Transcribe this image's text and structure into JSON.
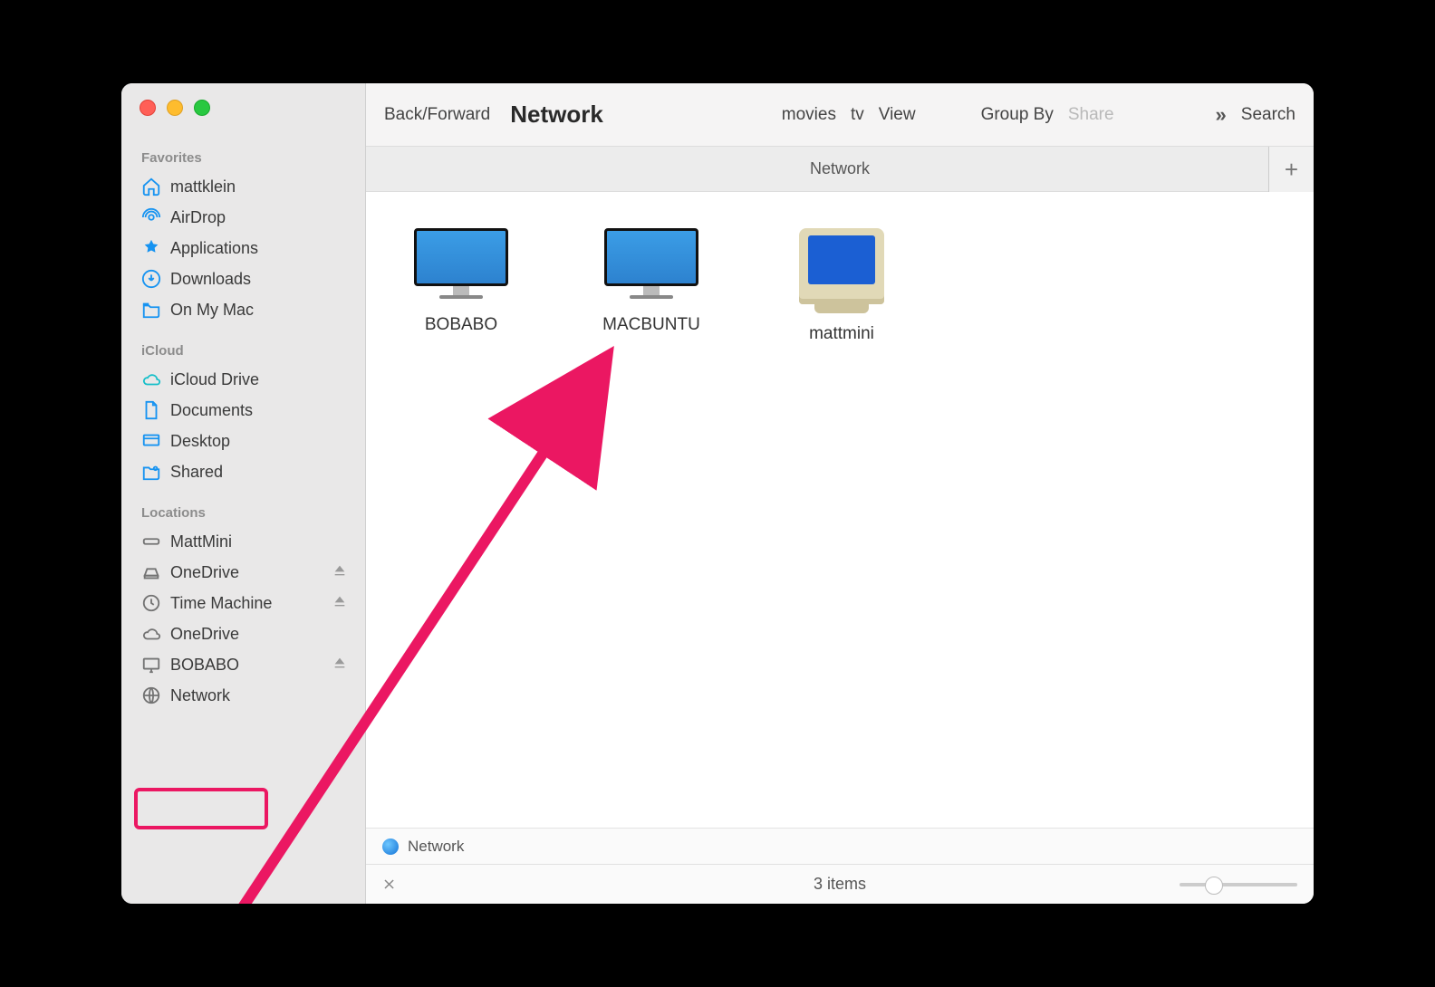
{
  "toolbar": {
    "back_forward": "Back/Forward",
    "title": "Network",
    "movies": "movies",
    "tv": "tv",
    "view": "View",
    "group_by": "Group By",
    "share": "Share",
    "search": "Search"
  },
  "tab": {
    "label": "Network"
  },
  "sidebar": {
    "favorites": {
      "title": "Favorites",
      "items": [
        "mattklein",
        "AirDrop",
        "Applications",
        "Downloads",
        "On My Mac"
      ]
    },
    "icloud": {
      "title": "iCloud",
      "items": [
        "iCloud Drive",
        "Documents",
        "Desktop",
        "Shared"
      ]
    },
    "locations": {
      "title": "Locations",
      "items": [
        "MattMini",
        "OneDrive",
        "Time Machine",
        "OneDrive",
        "BOBABO",
        "Network"
      ]
    }
  },
  "network_items": [
    {
      "name": "BOBABO",
      "kind": "mac"
    },
    {
      "name": "MACBUNTU",
      "kind": "mac"
    },
    {
      "name": "mattmini",
      "kind": "crt"
    }
  ],
  "pathbar": {
    "label": "Network"
  },
  "status": {
    "count": "3 items"
  }
}
